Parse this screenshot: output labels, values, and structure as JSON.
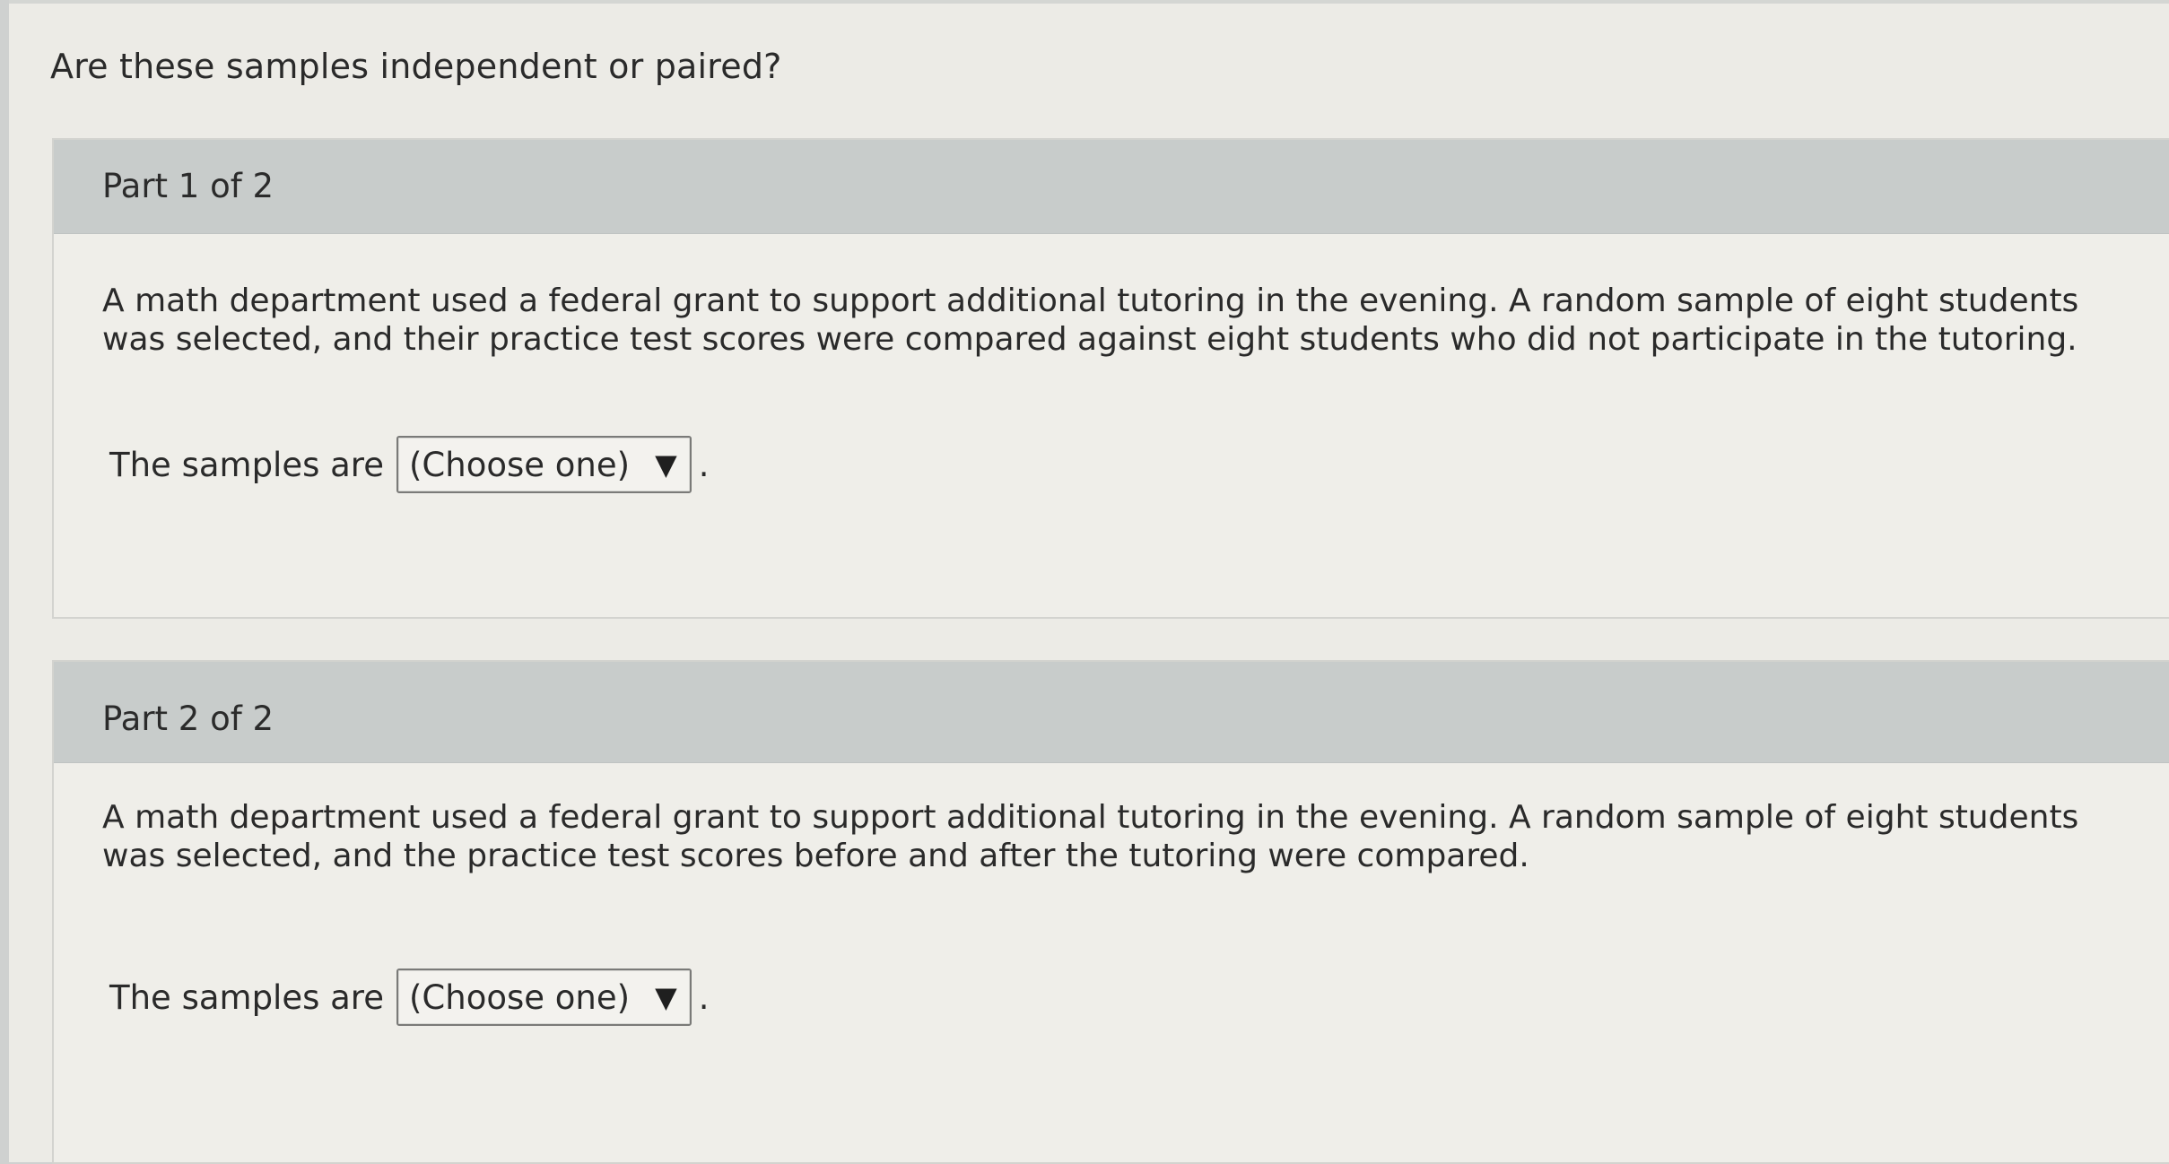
{
  "question": "Are these samples independent or paired?",
  "parts": [
    {
      "title": "Part 1 of 2",
      "prompt": "A math department used a federal grant to support additional tutoring in the evening. A random sample of eight students was selected, and their practice test scores were compared against eight students who did not participate in the tutoring.",
      "answer_label": "The samples are",
      "select_value": "(Choose one)",
      "caret": "▼",
      "period": "."
    },
    {
      "title": "Part 2 of 2",
      "prompt": "A math department used a federal grant to support additional tutoring in the evening. A random sample of eight students was selected, and the practice test scores before and after the tutoring were compared.",
      "answer_label": "The samples are",
      "select_value": "(Choose one)",
      "caret": "▼",
      "period": "."
    }
  ],
  "icons": {
    "dropdown": "caret-down-icon"
  }
}
